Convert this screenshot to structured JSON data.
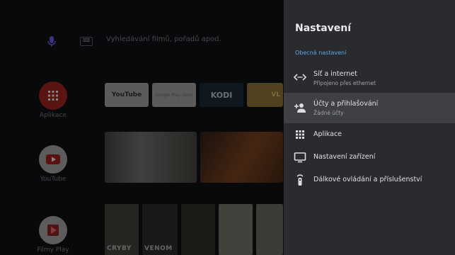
{
  "launcher": {
    "search_placeholder": "Vyhledávání filmů, pořadů apod.",
    "rows": [
      {
        "label": "Aplikace",
        "icon": "apps-grid-icon"
      },
      {
        "label": "YouTube",
        "icon": "youtube-icon"
      },
      {
        "label": "Filmy Play",
        "icon": "play-movies-icon"
      }
    ],
    "app_tiles": [
      {
        "label": "YouTube",
        "icon": "youtube-icon"
      },
      {
        "label": "Google Play Store",
        "icon": "play-store-icon"
      },
      {
        "label": "KODI",
        "icon": "kodi-icon"
      },
      {
        "label": "VL",
        "icon": "vlc-icon"
      }
    ],
    "posters": [
      "CRYBY",
      "VENOM",
      "",
      "",
      ""
    ]
  },
  "settings": {
    "title": "Nastavení",
    "section": "Obecná nastavení",
    "items": [
      {
        "title": "Síť a internet",
        "subtitle": "Připojeno přes ethernet",
        "icon": "network-arrows-icon",
        "selected": false
      },
      {
        "title": "Účty a přihlašování",
        "subtitle": "Žádné účty",
        "icon": "add-person-icon",
        "selected": true
      },
      {
        "title": "Aplikace",
        "subtitle": "",
        "icon": "apps-grid-icon",
        "selected": false
      },
      {
        "title": "Nastavení zařízení",
        "subtitle": "",
        "icon": "tv-icon",
        "selected": false
      },
      {
        "title": "Dálkové ovládání a příslušenství",
        "subtitle": "",
        "icon": "remote-icon",
        "selected": false
      }
    ]
  },
  "colors": {
    "accent": "#5fa7e3",
    "panel_bg": "#2a2b2e",
    "selected_bg": "#3e4044"
  }
}
